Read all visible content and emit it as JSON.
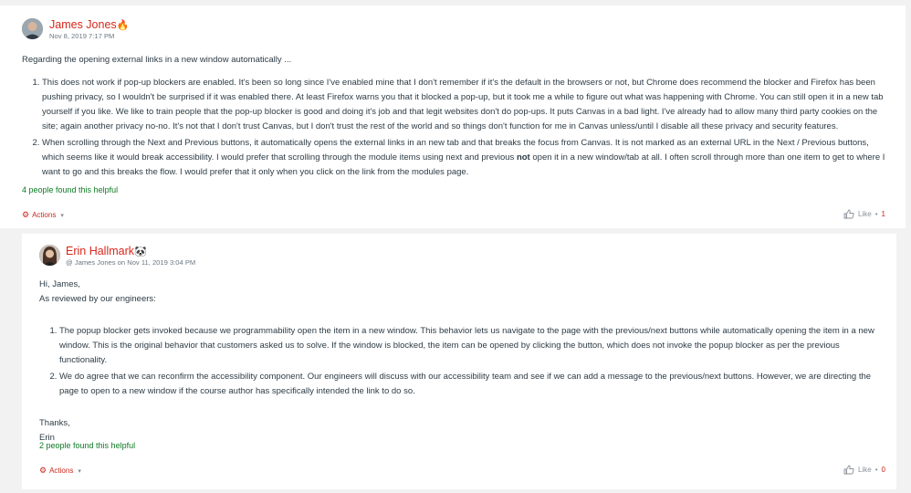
{
  "post1": {
    "author": "James Jones",
    "badge_icon": "fire-icon",
    "date": "Nov 8, 2019 7:17 PM",
    "intro": "Regarding the opening external links in a new window automatically ...",
    "items": [
      "This does not work if pop-up blockers are enabled. It's been so long since I've enabled mine that I don't remember if it's the default in the browsers or not, but Chrome does recommend the blocker and Firefox has been pushing privacy, so I wouldn't be surprised if it was enabled there. At least Firefox warns you that it blocked a pop-up, but it took me a while to figure out what was happening with Chrome. You can still open it in a new tab yourself if you like. We like to train people that the pop-up blocker is good and doing it's job and that legit websites don't do pop-ups. It puts Canvas in a bad light. I've already had to allow many third party cookies on the site; again another privacy no-no. It's not that I don't trust Canvas, but I don't trust the rest of the world and so things don't function for me in Canvas unless/until I disable all these privacy and security features."
    ],
    "item2_before": "When scrolling through the Next and Previous buttons, it automatically opens the external links in an new tab and that breaks the focus from Canvas. It is not marked as an external URL in the Next / Previous buttons, which seems like it would break accessibility. I would prefer that scrolling through the module items using next and previous ",
    "item2_bold": "not",
    "item2_after": " open it in a new window/tab at all. I often scroll through more than one item to get to where I want to go and this breaks the flow. I would prefer that it only when you click on the link from the modules page.",
    "helpful": "4 people found this helpful",
    "actions_label": "Actions",
    "like_label": "Like",
    "like_sep": "•",
    "like_count": "1"
  },
  "post2": {
    "author": "Erin Hallmark",
    "badge_icon": "panda-icon",
    "reply_meta": "@ James Jones on Nov 11, 2019 3:04 PM",
    "greeting": "Hi, James,",
    "intro": "As reviewed by our engineers:",
    "items": [
      "The popup blocker gets invoked because we programmability open the item in a new window. This behavior lets us navigate to the page with the previous/next buttons while automatically opening the item in a new window. This is the original behavior that customers asked us to solve. If the window is blocked, the item can be opened by clicking the button, which does not invoke the popup blocker as per the previous functionality.",
      "We do agree that we can reconfirm the accessibility component. Our engineers will discuss with our accessibility team and see if we can add a message to the previous/next buttons. However, we are directing the page to open to a new window if the course author has specifically intended the link to do so."
    ],
    "closing": "Thanks,",
    "signature": "Erin",
    "helpful": "2 people found this helpful",
    "actions_label": "Actions",
    "like_label": "Like",
    "like_sep": "•",
    "like_count": "0"
  }
}
